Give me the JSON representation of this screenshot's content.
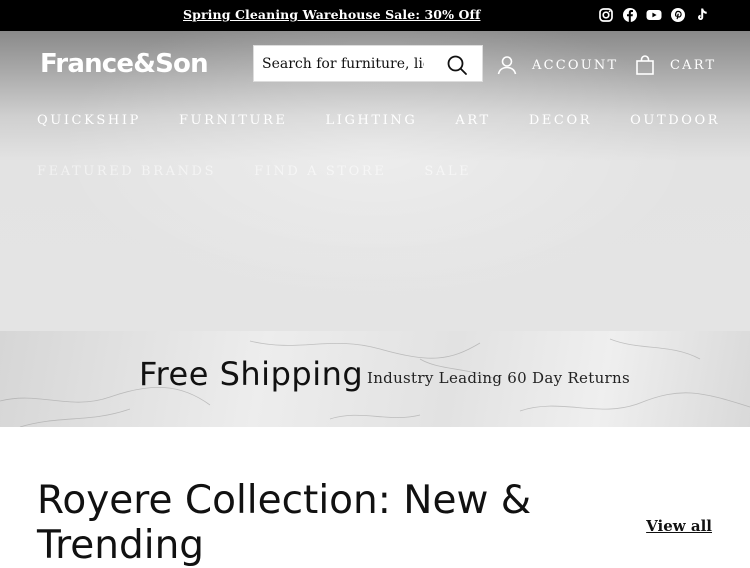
{
  "announcement": {
    "text": "Spring Cleaning Warehouse Sale: 30% Off"
  },
  "social": [
    "instagram-icon",
    "facebook-icon",
    "youtube-icon",
    "pinterest-icon",
    "tiktok-icon"
  ],
  "header": {
    "logo": "France&Son",
    "search_placeholder": "Search for furniture, lighting",
    "account_label": "ACCOUNT",
    "cart_label": "CART"
  },
  "nav": {
    "row1": [
      "QUICKSHIP",
      "FURNITURE",
      "LIGHTING",
      "ART",
      "DECOR",
      "OUTDOOR"
    ],
    "row2": [
      "FEATURED BRANDS",
      "FIND A STORE",
      "SALE"
    ]
  },
  "promo": {
    "title": "Free Shipping",
    "subtitle": "Industry Leading 60 Day Returns"
  },
  "collection": {
    "title": "Royere Collection: New & Trending",
    "view_all": "View all"
  },
  "colors": {
    "announcement_bg": "#000000",
    "text": "#111111"
  }
}
